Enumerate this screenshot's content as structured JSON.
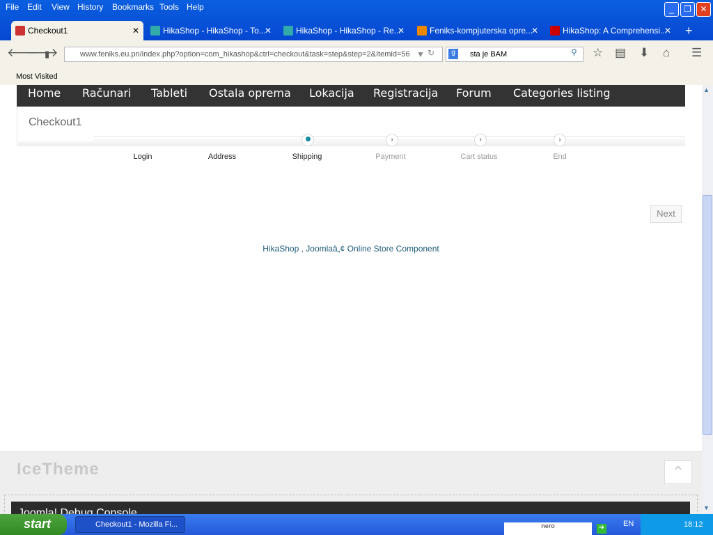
{
  "menu": [
    "File",
    "Edit",
    "View",
    "History",
    "Bookmarks",
    "Tools",
    "Help"
  ],
  "tabs": [
    {
      "label": "Checkout1"
    },
    {
      "label": "HikaShop - HikaShop - To..."
    },
    {
      "label": "HikaShop - HikaShop - Re..."
    },
    {
      "label": "Feniks-kompjuterska opre..."
    },
    {
      "label": "HikaShop: A Comprehensi..."
    }
  ],
  "url": "www.feniks.eu.pn/index.php?option=com_hikashop&ctrl=checkout&task=step&step=2&Itemid=56",
  "search": "sta je BAM",
  "bookmarks": {
    "most_visited": "Most Visited"
  },
  "nav": [
    "Home",
    "Računari",
    "Tableti",
    "Ostala oprema",
    "Lokacija",
    "Registracija",
    "Forum",
    "Categories listing"
  ],
  "page_title": "Checkout1",
  "steps": [
    {
      "label": "Login",
      "state": "done"
    },
    {
      "label": "Address",
      "state": "done"
    },
    {
      "label": "Shipping",
      "state": "current"
    },
    {
      "label": "Payment",
      "state": "todo"
    },
    {
      "label": "Cart status",
      "state": "todo"
    },
    {
      "label": "End",
      "state": "todo"
    }
  ],
  "next": "Next",
  "footer_text": "HikaShop , Joomlaâ„¢ Online Store Component",
  "brand": "IceTheme",
  "debug": "Joomla! Debug Console",
  "taskbar": {
    "start": "start",
    "window": "Checkout1 - Mozilla Fi...",
    "lang": "EN",
    "time": "18:12"
  },
  "colors": {
    "accent": "#1a8aa0",
    "nav_bg": "#333333"
  }
}
